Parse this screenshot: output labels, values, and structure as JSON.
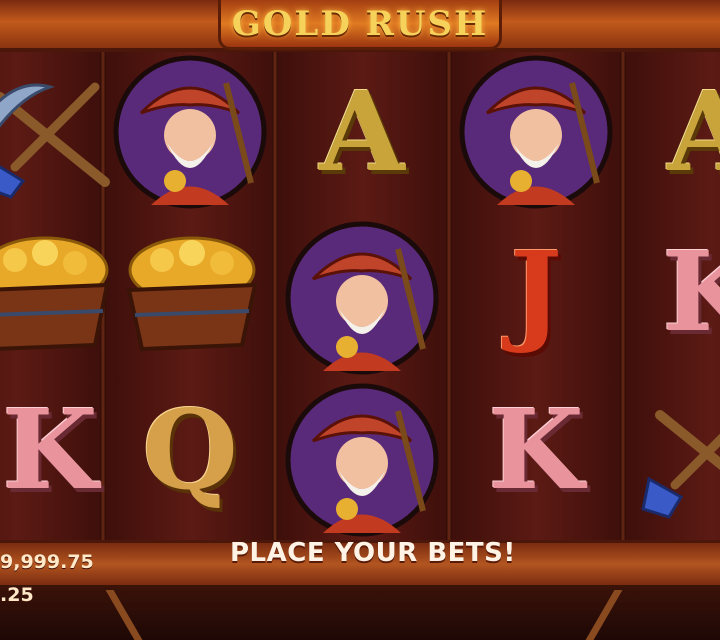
{
  "logo": {
    "title": "GOLD RUSH"
  },
  "reels": [
    {
      "id": "reel-1",
      "symbols": [
        "pickaxe-shovel",
        "gold-cart",
        "K"
      ]
    },
    {
      "id": "reel-2",
      "symbols": [
        "miner",
        "gold-cart",
        "Q"
      ]
    },
    {
      "id": "reel-3",
      "symbols": [
        "A",
        "miner",
        "miner"
      ]
    },
    {
      "id": "reel-4",
      "symbols": [
        "miner",
        "J",
        "K"
      ]
    },
    {
      "id": "reel-5",
      "symbols": [
        "A",
        "K",
        "pickaxe-shovel"
      ]
    }
  ],
  "symbol_labels": {
    "A": "A",
    "J": "J",
    "K": "K",
    "Q": "Q"
  },
  "message": "PLACE YOUR BETS!",
  "balance": "9,999.75",
  "bet": ".25",
  "colors": {
    "gold": "#c9a43a",
    "red": "#d83a1c",
    "pink": "#e9949c",
    "frame": "#c25a1c"
  }
}
